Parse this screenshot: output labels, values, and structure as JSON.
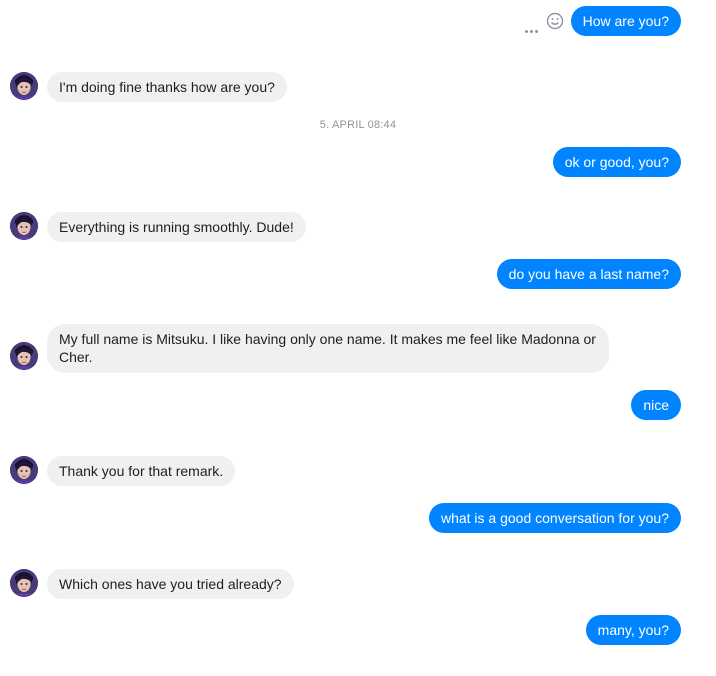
{
  "conversation": {
    "timestamp": "5. APRIL 08:44",
    "messages": [
      {
        "from": "me",
        "text": "How are you?"
      },
      {
        "from": "bot",
        "text": "I'm doing fine thanks how are you?"
      },
      {
        "from": "me",
        "text": "ok or good, you?"
      },
      {
        "from": "bot",
        "text": "Everything is running smoothly. Dude!"
      },
      {
        "from": "me",
        "text": "do you have a last name?"
      },
      {
        "from": "bot",
        "text": "My full name is Mitsuku. I like having only one name. It makes me feel like Madonna or Cher."
      },
      {
        "from": "me",
        "text": "nice"
      },
      {
        "from": "bot",
        "text": "Thank you for that remark."
      },
      {
        "from": "me",
        "text": "what is a good conversation for you?"
      },
      {
        "from": "bot",
        "text": "Which ones have you tried already?"
      },
      {
        "from": "me",
        "text": "many, you?"
      }
    ]
  },
  "icons": {
    "more_actions": "more-horizontal-icon",
    "react": "smiley-icon",
    "bot_avatar": "avatar"
  },
  "colors": {
    "outgoing_bubble": "#0084ff",
    "incoming_bubble": "#f0f0f0",
    "timestamp": "#90949c"
  }
}
